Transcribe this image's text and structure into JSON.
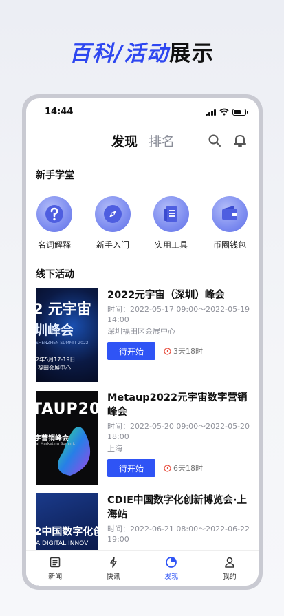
{
  "banner": {
    "accent_text": "百科/活动",
    "dark_text": "展示"
  },
  "status": {
    "time": "14:44"
  },
  "topnav": {
    "tab_active": "发现",
    "tab_inactive": "排名"
  },
  "beginner": {
    "title": "新手学堂",
    "items": [
      {
        "label": "名词解释",
        "icon": "question-icon"
      },
      {
        "label": "新手入门",
        "icon": "compass-icon"
      },
      {
        "label": "实用工具",
        "icon": "book-icon"
      },
      {
        "label": "币圈钱包",
        "icon": "wallet-icon"
      }
    ]
  },
  "offline": {
    "title": "线下活动",
    "events": [
      {
        "title": "2022元宇宙（深圳）峰会",
        "time": "时间：2022-05-17 09:00～2022-05-19 14:00",
        "location": "深圳福田区会展中心",
        "button": "待开始",
        "countdown": "3天18时",
        "thumb_lines": [
          "2 元宇宙",
          "圳峰会",
          "SHENZHEN SUMMIT 2022",
          "2年5月17-19日",
          "福田会展中心"
        ]
      },
      {
        "title": "Metaup2022元宇宙数字营销峰会",
        "time": "时间：2022-05-20 09:00～2022-05-20 18:00",
        "location": "上海",
        "button": "待开始",
        "countdown": "6天18时",
        "thumb_lines": [
          "TAUP20",
          "字营销峰会",
          "al Marketing Summit"
        ]
      },
      {
        "title": "CDIE中国数字化创新博览会·上海站",
        "time": "时间：2022-06-21 08:00～2022-06-22 19:00",
        "location": "",
        "button": "",
        "countdown": "",
        "thumb_lines": [
          "2中国数字化创",
          "A DIGITAL INNOV"
        ]
      }
    ]
  },
  "tabbar": {
    "items": [
      {
        "label": "新闻",
        "icon": "news-icon"
      },
      {
        "label": "快讯",
        "icon": "flash-icon"
      },
      {
        "label": "发现",
        "icon": "discover-icon"
      },
      {
        "label": "我的",
        "icon": "profile-icon"
      }
    ]
  },
  "colors": {
    "accent": "#2f54f5",
    "banner_accent": "#2e47f0"
  }
}
